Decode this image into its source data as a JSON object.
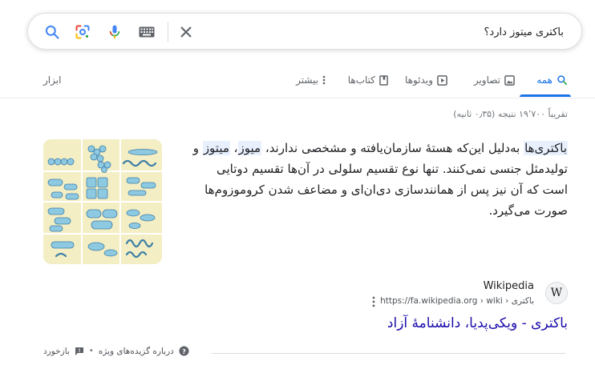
{
  "search": {
    "query": "باکتری میتوز دارد؟",
    "placeholder": ""
  },
  "tabs": {
    "all": "همه",
    "images": "تصاویر",
    "videos": "ویدئوها",
    "books": "کتاب‌ها",
    "more": "بیشتر",
    "tools": "ابزار"
  },
  "result_stats": "تقریباً ۱۹٬۷۰۰ نتیجه (۰٫۳۵ ثانیه)",
  "snippet": {
    "hl_1": "باکتری‌ها",
    "part_1": " به‌دلیل این‌که هستهٔ سازمان‌یافته و مشخصی ندارند، ",
    "hl_2": "میوز",
    "part_2": "، ",
    "hl_3": "میتوز",
    "part_3": " و تولیدمثل جنسی نمی‌کنند. تنها نوع تقسیم سلولی در آن‌ها تقسیم دوتایی است که آن نیز پس از همانندسازی دی‌ان‌ای و مضاعف شدن کروموزوم‌ها صورت می‌گیرد."
  },
  "source": {
    "favicon_letter": "W",
    "site_name": "Wikipedia",
    "breadcrumb": "https://fa.wikipedia.org › wiki › باکتری",
    "title": "باکتری - ویکی‌پدیا، دانشنامهٔ آزاد"
  },
  "footer": {
    "about": "درباره گزیده‌های ویژه",
    "separator": "•",
    "feedback": "بازخورد"
  },
  "colors": {
    "accent": "#1a73e8",
    "link": "#1a0dab",
    "highlight": "#e8f0fe"
  }
}
